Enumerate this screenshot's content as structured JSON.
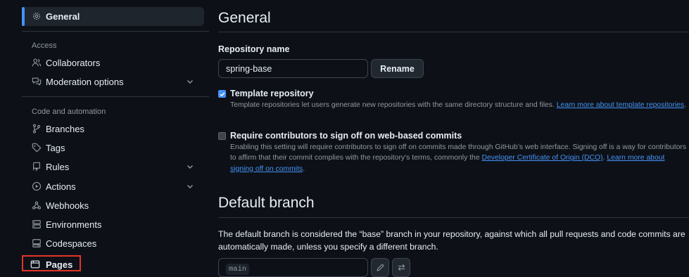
{
  "sidebar": {
    "general": {
      "label": "General",
      "icon": "gear-icon"
    },
    "sections": {
      "access": "Access",
      "code_automation": "Code and automation"
    },
    "items": {
      "collaborators": {
        "label": "Collaborators",
        "icon": "people-icon"
      },
      "moderation": {
        "label": "Moderation options",
        "icon": "comment-discussion-icon"
      },
      "branches": {
        "label": "Branches",
        "icon": "git-branch-icon"
      },
      "tags": {
        "label": "Tags",
        "icon": "tag-icon"
      },
      "rules": {
        "label": "Rules",
        "icon": "repo-push-icon"
      },
      "actions": {
        "label": "Actions",
        "icon": "play-icon"
      },
      "webhooks": {
        "label": "Webhooks",
        "icon": "webhook-icon"
      },
      "environments": {
        "label": "Environments",
        "icon": "server-icon"
      },
      "codespaces": {
        "label": "Codespaces",
        "icon": "codespaces-icon"
      },
      "pages": {
        "label": "Pages",
        "icon": "browser-icon"
      }
    }
  },
  "main": {
    "title": "General",
    "repo_name": {
      "label": "Repository name",
      "value": "spring-base",
      "rename_button": "Rename"
    },
    "template_option": {
      "checked": true,
      "title": "Template repository",
      "desc_text": "Template repositories let users generate new repositories with the same directory structure and files. ",
      "link": "Learn more about template repositories",
      "desc_end": "."
    },
    "signoff_option": {
      "checked": false,
      "title": "Require contributors to sign off on web-based commits",
      "desc_text": "Enabling this setting will require contributors to sign off on commits made through GitHub’s web interface. Signing off is a way for contributors to affirm that their commit complies with the repository's terms, commonly the ",
      "link1": "Developer Certificate of Origin (DCO)",
      "desc_mid": ". ",
      "link2": "Learn more about signing off on commits",
      "desc_end": "."
    },
    "default_branch": {
      "title": "Default branch",
      "description": "The default branch is considered the “base” branch in your repository, against which all pull requests and code commits are automatically made, unless you specify a different branch.",
      "branch": "main"
    }
  },
  "colors": {
    "background": "#0d1117",
    "accent": "#4493f8",
    "highlight_box": "#e5332a",
    "muted_text": "#9198a1",
    "border": "#30363d"
  }
}
